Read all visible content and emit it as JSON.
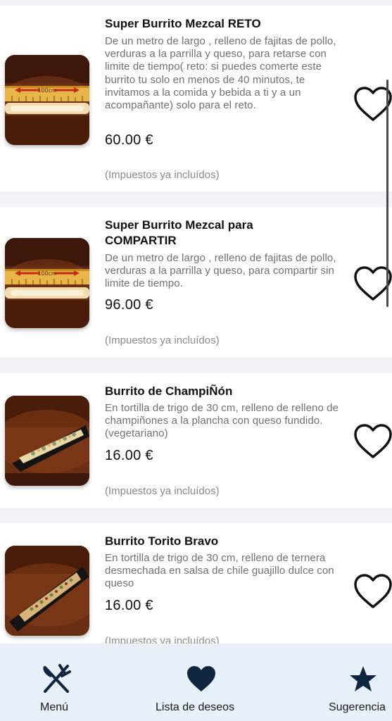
{
  "colors": {
    "nav_background": "#e8f0f9",
    "nav_icon": "#10263e",
    "heart_outline": "#111111"
  },
  "menu_items": [
    {
      "title": "Super Burrito Mezcal RETO",
      "description": "De un metro de largo , relleno de fajitas de pollo, verduras a la parrilla y queso, para retarse con limite de tiempo( reto: si puedes comerte este burrito tu solo en menos de 40 minutos, te invitamos a la comida y bebida a ti y a un acompañante) solo para el reto.",
      "price": "60.00 €",
      "tax_note": "(Impuestos ya incluídos)",
      "ruler_label": "100cm",
      "favorite_icon": "heart-outline-icon"
    },
    {
      "title": "Super Burrito Mezcal para COMPARTIR",
      "description": "De un metro de largo , relleno de fajitas de pollo, verduras a la parrilla y queso, para compartir sin limite de tiempo.",
      "price": "96.00 €",
      "tax_note": "(Impuestos ya incluídos)",
      "ruler_label": "100cm",
      "favorite_icon": "heart-outline-icon"
    },
    {
      "title": "Burrito de ChampiÑón",
      "description": "En tortilla de trigo de 30 cm, relleno de relleno de champiñones a la plancha con queso fundido. (vegetariano)",
      "price": "16.00 €",
      "tax_note": "(Impuestos ya incluídos)",
      "favorite_icon": "heart-outline-icon"
    },
    {
      "title": "Burrito Torito Bravo",
      "description": "En tortilla de trigo de 30 cm, relleno de ternera desmechada en salsa de chile guajillo dulce con queso",
      "price": "16.00 €",
      "tax_note": "(Impuestos ya incluídos)",
      "favorite_icon": "heart-outline-icon"
    }
  ],
  "bottom_nav": [
    {
      "label": "Menú",
      "icon": "fork-knife-icon"
    },
    {
      "label": "Lista de deseos",
      "icon": "heart-icon"
    },
    {
      "label": "Sugerencia",
      "icon": "star-icon"
    }
  ]
}
